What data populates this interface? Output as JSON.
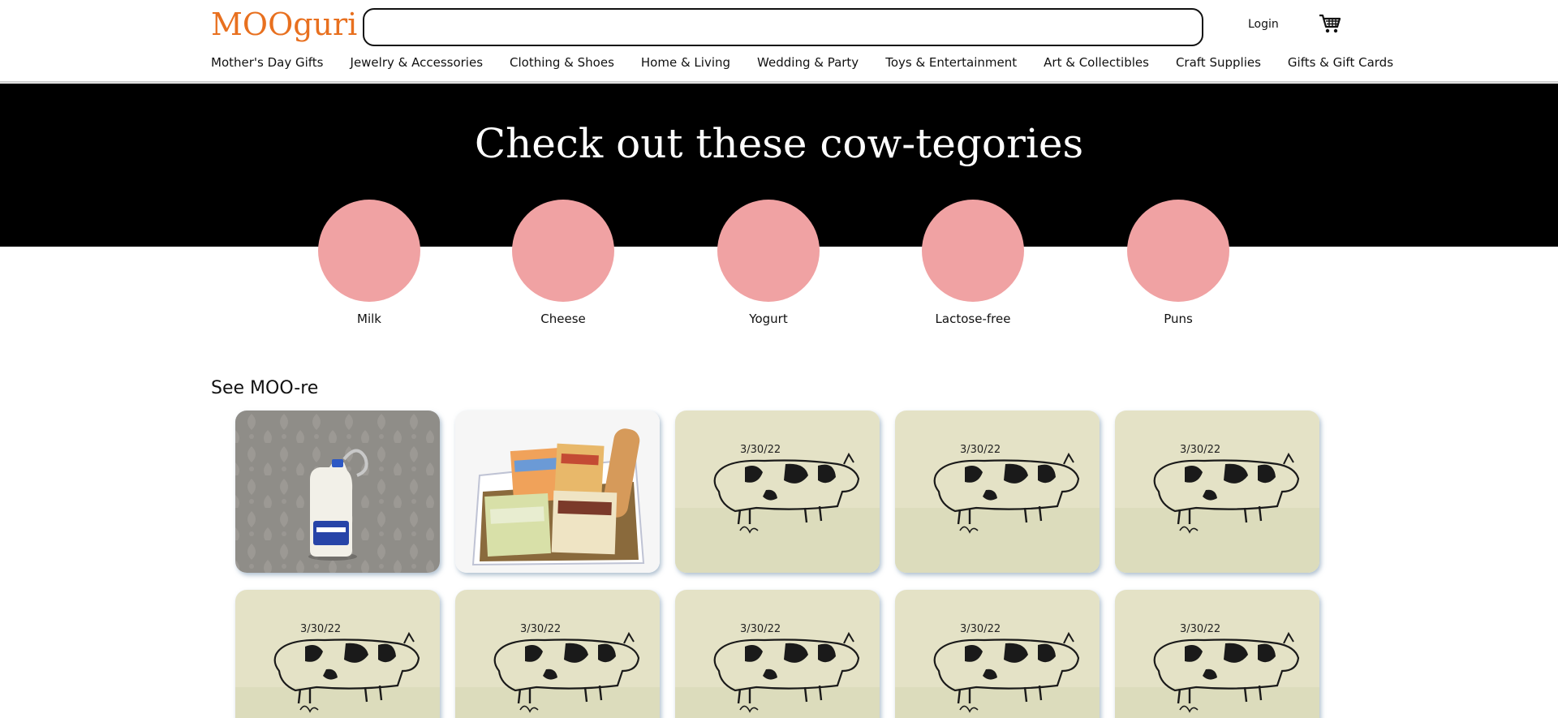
{
  "header": {
    "logo": "MOOguri",
    "search_placeholder": "",
    "login": "Login",
    "cart_icon": "cart-icon"
  },
  "nav": [
    "Mother's Day Gifts",
    "Jewelry & Accessories",
    "Clothing & Shoes",
    "Home & Living",
    "Wedding & Party",
    "Toys & Entertainment",
    "Art & Collectibles",
    "Craft Supplies",
    "Gifts & Gift Cards"
  ],
  "hero": {
    "title": "Check out these cow-tegories",
    "circle_color": "#f0a2a3"
  },
  "categories": [
    "Milk",
    "Cheese",
    "Yogurt",
    "Lactose-free",
    "Puns"
  ],
  "see_more": {
    "title": "See MOO-re",
    "products": [
      {
        "image": "milk-jug-keychain"
      },
      {
        "image": "cheese-gift-box"
      },
      {
        "image": "cow-sketch",
        "sketch_date": "3/30/22"
      },
      {
        "image": "cow-sketch",
        "sketch_date": "3/30/22"
      },
      {
        "image": "cow-sketch",
        "sketch_date": "3/30/22"
      },
      {
        "image": "cow-sketch",
        "sketch_date": "3/30/22"
      },
      {
        "image": "cow-sketch",
        "sketch_date": "3/30/22"
      },
      {
        "image": "cow-sketch",
        "sketch_date": "3/30/22"
      },
      {
        "image": "cow-sketch",
        "sketch_date": "3/30/22"
      },
      {
        "image": "cow-sketch",
        "sketch_date": "3/30/22"
      }
    ]
  }
}
